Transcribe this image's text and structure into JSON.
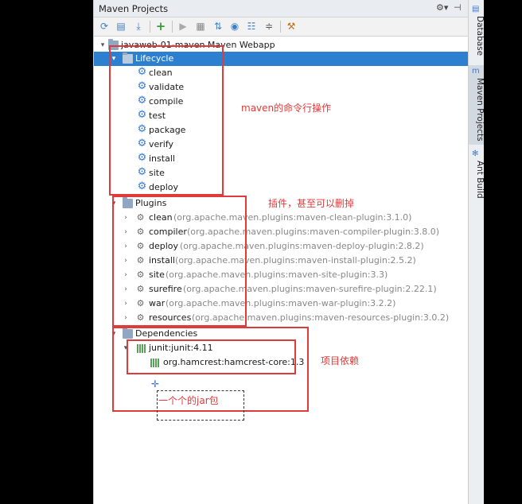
{
  "panel": {
    "title": "Maven Projects",
    "title_icons": [
      "gear-icon",
      "pin-icon"
    ]
  },
  "toolbar": {
    "icons": [
      "reimport-icon",
      "generate-sources-icon",
      "download-icon",
      "add-icon",
      "run-icon",
      "execute-goal-icon",
      "toggle-offline-icon",
      "skip-tests-icon",
      "show-dependencies-icon",
      "collapse-all-icon",
      "settings-icon"
    ]
  },
  "tree": {
    "project": "javaweb-01-maven Maven Webapp",
    "lifecycle": {
      "label": "Lifecycle",
      "items": [
        "clean",
        "validate",
        "compile",
        "test",
        "package",
        "verify",
        "install",
        "site",
        "deploy"
      ]
    },
    "plugins": {
      "label": "Plugins",
      "items": [
        {
          "name": "clean",
          "detail": "(org.apache.maven.plugins:maven-clean-plugin:3.1.0)"
        },
        {
          "name": "compiler",
          "detail": "(org.apache.maven.plugins:maven-compiler-plugin:3.8.0)"
        },
        {
          "name": "deploy",
          "detail": "(org.apache.maven.plugins:maven-deploy-plugin:2.8.2)"
        },
        {
          "name": "install",
          "detail": "(org.apache.maven.plugins:maven-install-plugin:2.5.2)"
        },
        {
          "name": "site",
          "detail": "(org.apache.maven.plugins:maven-site-plugin:3.3)"
        },
        {
          "name": "surefire",
          "detail": "(org.apache.maven.plugins:maven-surefire-plugin:2.22.1)"
        },
        {
          "name": "war",
          "detail": "(org.apache.maven.plugins:maven-war-plugin:3.2.2)"
        },
        {
          "name": "resources",
          "detail": "(org.apache.maven.plugins:maven-resources-plugin:3.0.2)"
        }
      ]
    },
    "dependencies": {
      "label": "Dependencies",
      "items": [
        {
          "name": "junit:junit:4.11",
          "children": [
            "org.hamcrest:hamcrest-core:1.3"
          ]
        }
      ]
    }
  },
  "annotations": {
    "lifecycle_note": "maven的命令行操作",
    "plugins_note": "插件，甚至可以删掉",
    "deps_note": "项目依赖",
    "jar_note": "一个个的jar包"
  },
  "rightbar": {
    "tabs": [
      "Database",
      "Maven Projects",
      "Ant Build"
    ]
  }
}
